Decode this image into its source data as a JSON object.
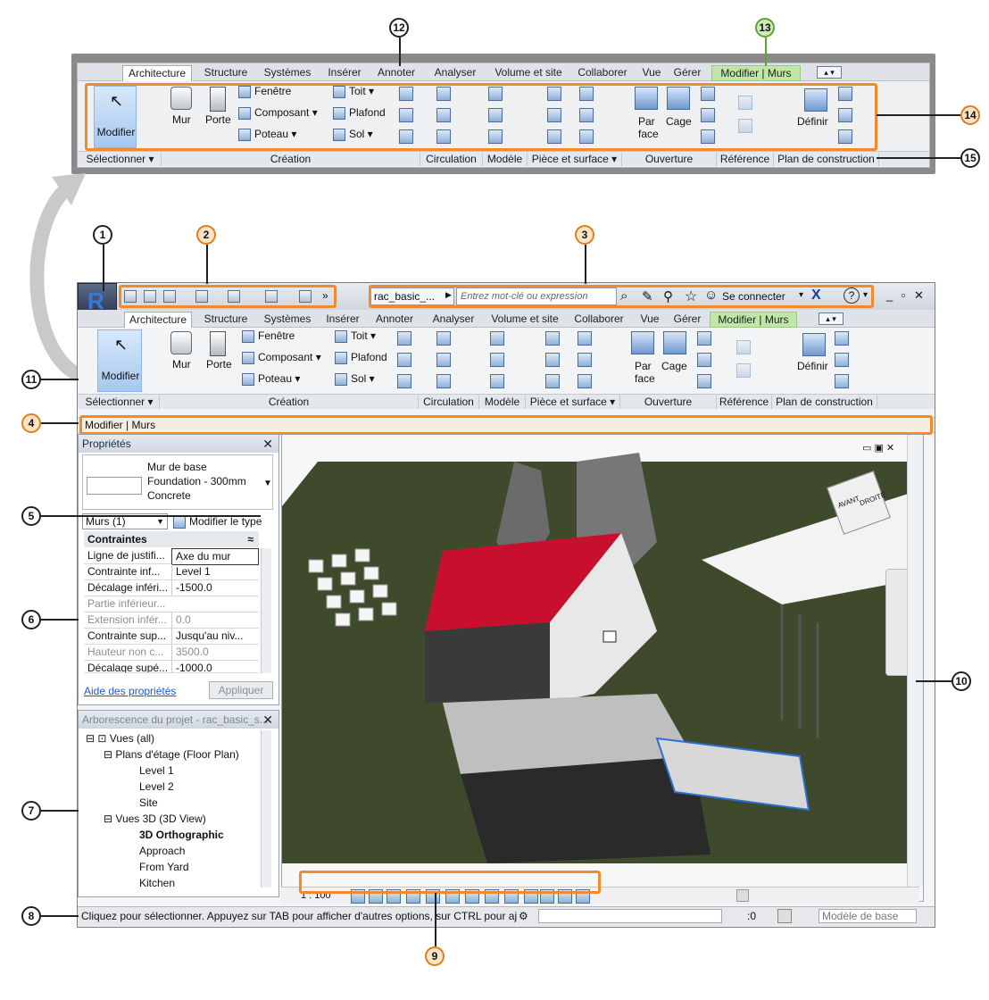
{
  "ribbon": {
    "tabs": [
      "Architecture",
      "Structure",
      "Systèmes",
      "Insérer",
      "Annoter",
      "Analyser",
      "Volume et site",
      "Collaborer",
      "Vue",
      "Gérer",
      "Modifier | Murs"
    ],
    "modify_label": "Modifier",
    "wall_label": "Mur",
    "door_label": "Porte",
    "window_label": "Fenêtre",
    "component_label": "Composant",
    "column_label": "Poteau",
    "roof_label": "Toit",
    "ceiling_label": "Plafond",
    "floor_label": "Sol",
    "by_face_label_1": "Par",
    "by_face_label_2": "face",
    "shaft_label": "Cage",
    "set_label": "Définir",
    "panels": [
      "Sélectionner ▾",
      "Création",
      "Circulation",
      "Modèle",
      "Pièce et surface ▾",
      "Ouverture",
      "Référence",
      "Plan de construction"
    ]
  },
  "titlebar": {
    "filename": "rac_basic_...",
    "search_placeholder": "Entrez mot-clé ou expression",
    "signin": "Se connecter",
    "help": "?",
    "window_controls": "_ ▫ ✕"
  },
  "options_bar": {
    "text": "Modifier | Murs"
  },
  "properties": {
    "title": "Propriétés",
    "type_line1": "Mur de base",
    "type_line2": "Foundation - 300mm",
    "type_line3": "Concrete",
    "selector": "Murs (1)",
    "edit_type": "Modifier le type",
    "group": "Contraintes",
    "rows": [
      {
        "k": "Ligne de justifi...",
        "v": "Axe du mur"
      },
      {
        "k": "Contrainte inf...",
        "v": "Level 1"
      },
      {
        "k": "Décalage inféri...",
        "v": "-1500.0"
      },
      {
        "k": "Partie inférieur...",
        "v": ""
      },
      {
        "k": "Extension infér...",
        "v": "0.0"
      },
      {
        "k": "Contrainte sup...",
        "v": "Jusqu'au niv..."
      },
      {
        "k": "Hauteur non c...",
        "v": "3500.0"
      },
      {
        "k": "Décalage supé...",
        "v": "-1000.0"
      }
    ],
    "help_link": "Aide des propriétés",
    "apply": "Appliquer"
  },
  "browser": {
    "title": "Arborescence du projet - rac_basic_s...",
    "nodes": [
      "Vues (all)",
      "Plans d'étage (Floor Plan)",
      "Level 1",
      "Level 2",
      "Site",
      "Vues 3D (3D View)",
      "3D Orthographic",
      "Approach",
      "From Yard",
      "Kitchen"
    ]
  },
  "viewbar": {
    "scale": "1 : 100"
  },
  "status": {
    "text": "Cliquez pour sélectionner. Appuyez sur TAB pour afficher d'autres options, sur CTRL pour aj",
    "count": ":0",
    "model": "Modèle de base"
  },
  "viewcube": {
    "face1": "AVANT",
    "face2": "DROITE"
  },
  "callouts": [
    "1",
    "2",
    "3",
    "4",
    "5",
    "6",
    "7",
    "8",
    "9",
    "10",
    "11",
    "12",
    "13",
    "14",
    "15"
  ],
  "colors": {
    "accent_orange": "#f08a2d",
    "roof_red": "#c8102e",
    "context_tab": "#bfe7a8"
  }
}
